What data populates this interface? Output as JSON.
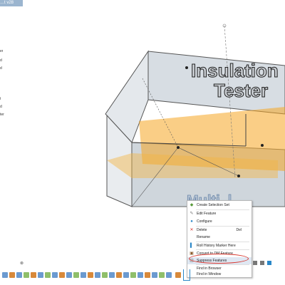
{
  "window": {
    "tab_label": "…t v28"
  },
  "browser": {
    "items": [
      "er",
      "d",
      "d",
      "",
      "",
      "t",
      "d",
      "ter"
    ]
  },
  "model": {
    "text_line1": "Insulation",
    "text_line2": "Tester",
    "text_line3": "Multi..l"
  },
  "context_menu": {
    "items": [
      {
        "icon": "selection-set-icon",
        "label": "Create Selection Set",
        "shortcut": ""
      },
      {
        "icon": "edit-feature-icon",
        "label": "Edit Feature",
        "shortcut": ""
      },
      {
        "icon": "configure-icon",
        "label": "Configure",
        "shortcut": ""
      },
      {
        "icon": "delete-icon",
        "label": "Delete",
        "shortcut": "Del"
      },
      {
        "icon": "",
        "label": "Rename",
        "shortcut": ""
      },
      {
        "icon": "roll-history-icon",
        "label": "Roll History Marker Here",
        "shortcut": ""
      },
      {
        "icon": "convert-dm-icon",
        "label": "Convert to DM Feature",
        "shortcut": ""
      },
      {
        "icon": "suppress-icon",
        "label": "Suppress Features",
        "shortcut": ""
      },
      {
        "icon": "",
        "label": "Find in Browser",
        "shortcut": ""
      },
      {
        "icon": "",
        "label": "Find in Window",
        "shortcut": ""
      }
    ]
  },
  "colors": {
    "accent": "#2a87c8",
    "highlight_circle": "#d9342b",
    "model_fill": "#c8d0d8",
    "selection": "#f5a623"
  }
}
